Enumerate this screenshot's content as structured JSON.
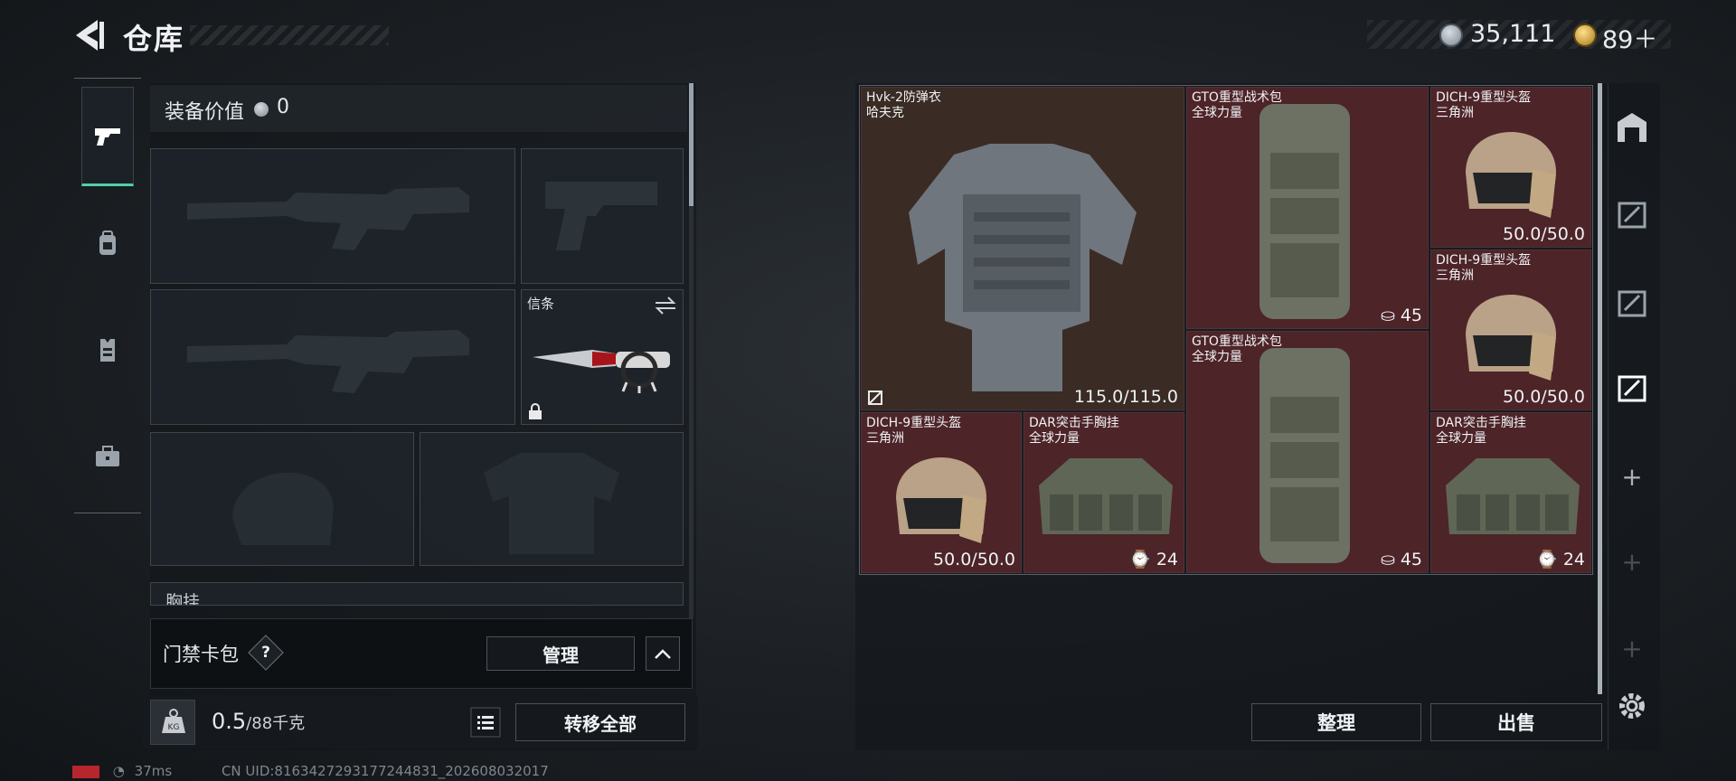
{
  "header": {
    "title": "仓库"
  },
  "currency": {
    "silver": "35,111",
    "gold": "89"
  },
  "equip": {
    "label": "装备价值",
    "value": "0"
  },
  "slots": {
    "melee_label": "信条",
    "chest_partial": "胸挂"
  },
  "card_bag": {
    "label": "门禁卡包",
    "help": "?",
    "manage": "管理"
  },
  "weight": {
    "current": "0.5",
    "max": "/88千克"
  },
  "buttons": {
    "transfer_all": "转移全部",
    "sort": "整理",
    "sell": "出售"
  },
  "status": {
    "ping": "37ms",
    "uid": "CN UID:8163427293177244831_202608032017"
  },
  "items": [
    {
      "name": "Hvk-2防弹衣",
      "maker": "哈夫克",
      "meta": "115.0/115.0",
      "bg": "brown"
    },
    {
      "name": "GTO重型战术包",
      "maker": "全球力量",
      "meta": "45",
      "bg": "red"
    },
    {
      "name": "DICH-9重型头盔",
      "maker": "三角洲",
      "meta": "50.0/50.0",
      "bg": "red"
    },
    {
      "name": "DICH-9重型头盔",
      "maker": "三角洲",
      "meta": "50.0/50.0",
      "bg": "red"
    },
    {
      "name": "GTO重型战术包",
      "maker": "全球力量",
      "meta": "45",
      "bg": "red"
    },
    {
      "name": "DICH-9重型头盔",
      "maker": "三角洲",
      "meta": "50.0/50.0",
      "bg": "red"
    },
    {
      "name": "DAR突击手胸挂",
      "maker": "全球力量",
      "meta": "24",
      "bg": "red"
    },
    {
      "name": "DAR突击手胸挂",
      "maker": "全球力量",
      "meta": "24",
      "bg": "red"
    }
  ],
  "colors": {
    "accent": "#4fd1a5",
    "item_red": "#4d2428",
    "item_brown": "#3a2b24"
  },
  "icons": [
    "back-arrow-icon",
    "coin-icon",
    "gold-coin-icon",
    "pistol-icon",
    "backpack-icon",
    "vest-icon",
    "briefcase-icon",
    "lock-icon",
    "swap-icon",
    "kg-weight-icon",
    "list-icon",
    "settings-icon"
  ]
}
